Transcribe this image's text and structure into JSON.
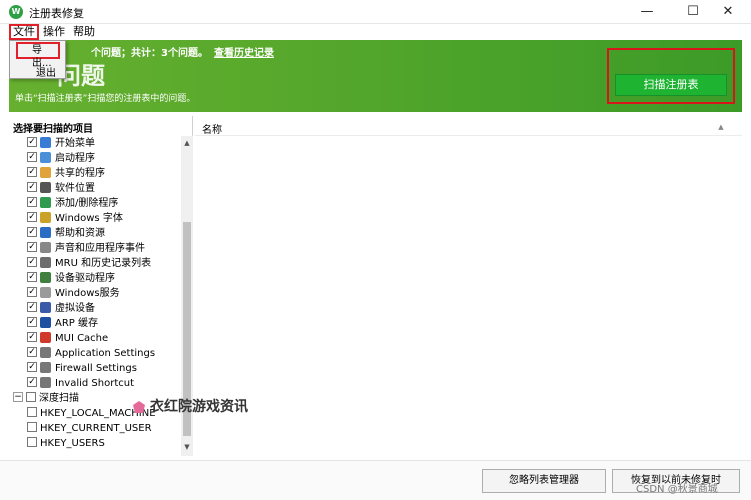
{
  "window": {
    "title": "注册表修复",
    "app_icon_text": "W",
    "minimize_glyph": "—",
    "maximize_glyph": "☐",
    "close_glyph": "✕"
  },
  "menu": {
    "file": "文件",
    "operation": "操作",
    "help": "帮助"
  },
  "dropdown": {
    "export": "导出...",
    "exit": "退出"
  },
  "banner": {
    "summary": "个问题；共计：3个问题。",
    "history_link": "查看历史记录",
    "heading": "问题",
    "description": "单击“扫描注册表”扫描您的注册表中的问题。",
    "scan_button": "扫描注册表"
  },
  "left_panel": {
    "header": "选择要扫描的项目",
    "items": [
      {
        "label": "开始菜单",
        "checked": true,
        "icon": "start-menu-icon",
        "color": "#3a7bd5"
      },
      {
        "label": "启动程序",
        "checked": true,
        "icon": "startup-programs-icon",
        "color": "#4a90d9"
      },
      {
        "label": "共享的程序",
        "checked": true,
        "icon": "shared-programs-icon",
        "color": "#e0a23a"
      },
      {
        "label": "软件位置",
        "checked": true,
        "icon": "software-location-icon",
        "color": "#555555"
      },
      {
        "label": "添加/删除程序",
        "checked": true,
        "icon": "add-remove-programs-icon",
        "color": "#2e9b4e"
      },
      {
        "label": "Windows 字体",
        "checked": true,
        "icon": "windows-fonts-icon",
        "color": "#c9a227"
      },
      {
        "label": "帮助和资源",
        "checked": true,
        "icon": "help-resources-icon",
        "color": "#2b6cc4"
      },
      {
        "label": "声音和应用程序事件",
        "checked": true,
        "icon": "sound-events-icon",
        "color": "#888888"
      },
      {
        "label": "MRU 和历史记录列表",
        "checked": true,
        "icon": "mru-history-icon",
        "color": "#6d6d6d"
      },
      {
        "label": "设备驱动程序",
        "checked": true,
        "icon": "device-drivers-icon",
        "color": "#3f7f3f"
      },
      {
        "label": "Windows服务",
        "checked": true,
        "icon": "windows-services-icon",
        "color": "#9a9a9a"
      },
      {
        "label": "虚拟设备",
        "checked": true,
        "icon": "virtual-devices-icon",
        "color": "#3a5ba8"
      },
      {
        "label": "ARP 缓存",
        "checked": true,
        "icon": "arp-cache-icon",
        "color": "#1e4fa0"
      },
      {
        "label": "MUI Cache",
        "checked": true,
        "icon": "mui-cache-icon",
        "color": "#d03a2a"
      },
      {
        "label": "Application Settings",
        "checked": true,
        "icon": "application-settings-icon",
        "color": "#777777"
      },
      {
        "label": "Firewall Settings",
        "checked": true,
        "icon": "firewall-settings-icon",
        "color": "#777777"
      },
      {
        "label": "Invalid Shortcut",
        "checked": true,
        "icon": "invalid-shortcut-icon",
        "color": "#777777"
      }
    ],
    "deep_scan": {
      "label": "深度扫描",
      "checked": false
    },
    "deep_items": [
      {
        "label": "HKEY_LOCAL_MACHINE",
        "checked": false
      },
      {
        "label": "HKEY_CURRENT_USER",
        "checked": false
      },
      {
        "label": "HKEY_USERS",
        "checked": false
      }
    ],
    "scroll_up_glyph": "▲",
    "scroll_down_glyph": "▼"
  },
  "right_panel": {
    "column_name": "名称",
    "scroll_glyph": "▲"
  },
  "buttons": {
    "ignore_list": "忽略列表管理器",
    "restore": "恢复到以前未修复时"
  },
  "watermark": {
    "text": "衣红院游戏资讯",
    "csdn": "CSDN @秋景商城"
  },
  "colors": {
    "banner_start": "#67b02f",
    "banner_end": "#3c9b27",
    "scan_button": "#1fb332",
    "highlight": "#e0202a"
  }
}
